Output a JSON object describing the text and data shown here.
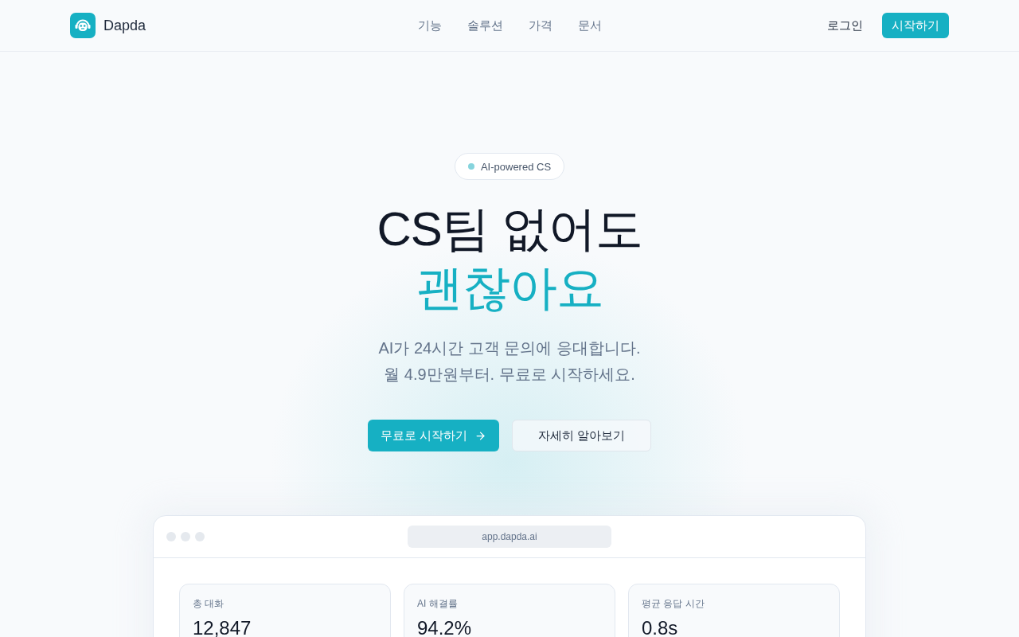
{
  "header": {
    "brand": "Dapda",
    "nav": [
      {
        "label": "기능"
      },
      {
        "label": "솔루션"
      },
      {
        "label": "가격"
      },
      {
        "label": "문서"
      }
    ],
    "login": "로그인",
    "cta": "시작하기"
  },
  "hero": {
    "badge": "AI-powered CS",
    "title_lines": [
      {
        "text": "CS팀 없어도",
        "kind": "plain"
      },
      {
        "text": "괜찮아요",
        "kind": "accent"
      }
    ],
    "subtitle_lines": [
      "AI가 24시간 고객 문의에 응대합니다.",
      "월 4.9만원부터. 무료로 시작하세요."
    ],
    "buttons": [
      {
        "label": "무료로 시작하기",
        "kind": "primary"
      },
      {
        "label": "자세히 알아보기",
        "kind": "secondary"
      }
    ]
  },
  "preview": {
    "url": "app.dapda.ai",
    "stats": [
      {
        "label": "총 대화",
        "value": "12,847"
      },
      {
        "label": "AI 해결률",
        "value": "94.2%"
      },
      {
        "label": "평균 응답 시간",
        "value": "0.8s"
      }
    ]
  }
}
